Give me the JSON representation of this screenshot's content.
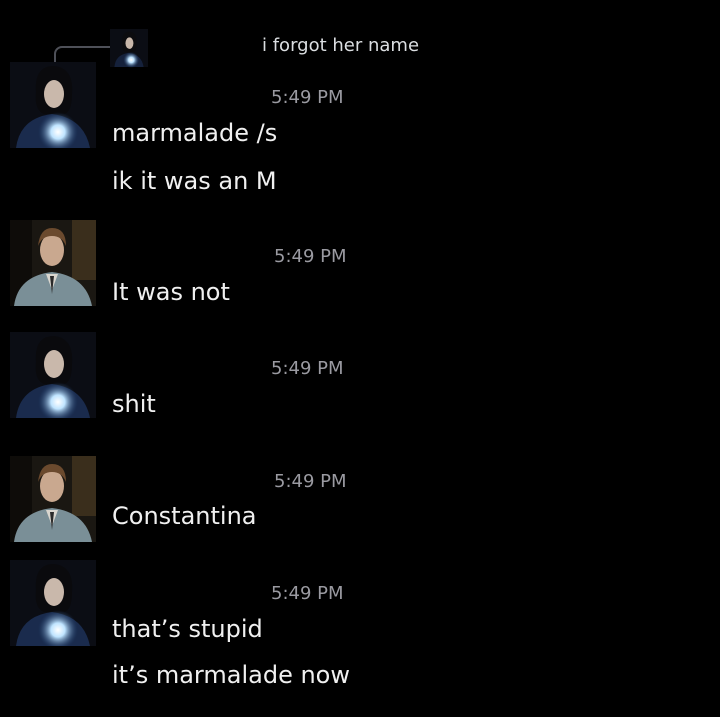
{
  "reply": {
    "avatar_icon": "snape-avatar-icon",
    "text": "i forgot her name"
  },
  "messages": [
    {
      "avatar_icon": "snape-avatar-icon",
      "time": "5:49 PM",
      "lines": [
        "marmalade /s",
        "ik it was an M"
      ]
    },
    {
      "avatar_icon": "lupin-avatar-icon",
      "time": "5:49 PM",
      "lines": [
        "It was not"
      ]
    },
    {
      "avatar_icon": "snape-avatar-icon",
      "time": "5:49 PM",
      "lines": [
        "shit"
      ]
    },
    {
      "avatar_icon": "lupin-avatar-icon",
      "time": "5:49 PM",
      "lines": [
        "Constantina"
      ]
    },
    {
      "avatar_icon": "snape-avatar-icon",
      "time": "5:49 PM",
      "lines": [
        "that’s stupid",
        "it’s marmalade now"
      ]
    }
  ],
  "colors": {
    "background": "#000000",
    "text": "#f0f0f0",
    "timestamp": "#9a9aa1",
    "reply_line": "#4e5058"
  }
}
